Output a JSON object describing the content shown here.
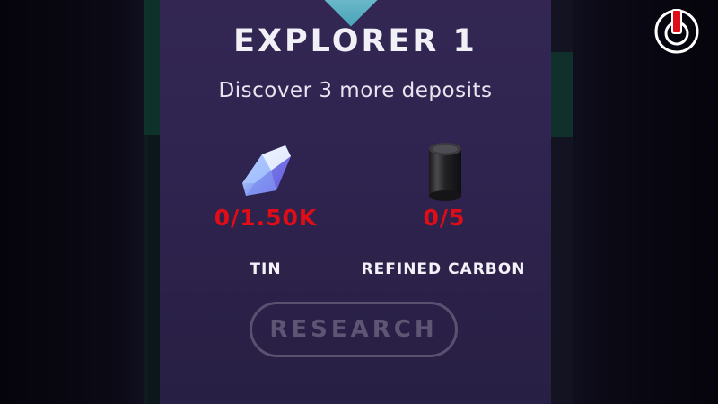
{
  "goal": {
    "title": "EXPLORER 1",
    "description": "Discover 3 more deposits"
  },
  "resources": [
    {
      "name": "TIN",
      "amount": "0/1.50K",
      "icon": "crystal-icon"
    },
    {
      "name": "REFINED CARBON",
      "amount": "0/5",
      "icon": "carbon-cylinder-icon"
    }
  ],
  "actions": {
    "research_label": "RESEARCH",
    "research_enabled": false
  },
  "colors": {
    "panel": "#2f2450",
    "requirement_unmet": "#e10d16",
    "button_disabled": "#5e5474",
    "power_accent": "#e0101a"
  },
  "top_right": {
    "icon": "power-icon"
  }
}
